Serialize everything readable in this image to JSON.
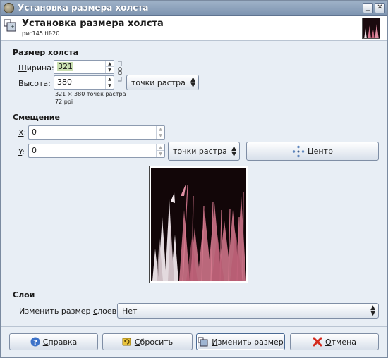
{
  "window": {
    "title": "Установка размера холста"
  },
  "header": {
    "title": "Установка размера холста",
    "subtitle": "рис145.tif-20"
  },
  "canvas_size": {
    "section_title": "Размер холста",
    "width_label_ul": "Ш",
    "width_label_rest": "ирина:",
    "width_value": "321",
    "height_label_ul": "В",
    "height_label_rest": "ысота:",
    "height_value": "380",
    "unit": "точки растра",
    "info_pixels": "321 × 380 точек растра",
    "info_ppi": "72 ppi"
  },
  "offset": {
    "section_title": "Смещение",
    "x_label_ul": "X",
    "x_label_rest": ":",
    "x_value": "0",
    "y_label_ul": "Y",
    "y_label_rest": ":",
    "y_value": "0",
    "unit": "точки растра",
    "center_label": "Центр"
  },
  "layers": {
    "section_title": "Слои",
    "resize_label_pre": "Изменить размер ",
    "resize_label_ul": "с",
    "resize_label_post": "лоев:",
    "resize_value": "Нет"
  },
  "buttons": {
    "help_ul": "С",
    "help_rest": "правка",
    "reset_ul": "С",
    "reset_rest": "бросить",
    "resize_ul": "И",
    "resize_rest": "зменить размер",
    "cancel_ul": "О",
    "cancel_rest": "тмена"
  },
  "colors": {
    "accent": "#7f95b1",
    "plant_pink": "#d87a90",
    "plant_white": "#efe6ea",
    "bg_dark": "#120608"
  }
}
